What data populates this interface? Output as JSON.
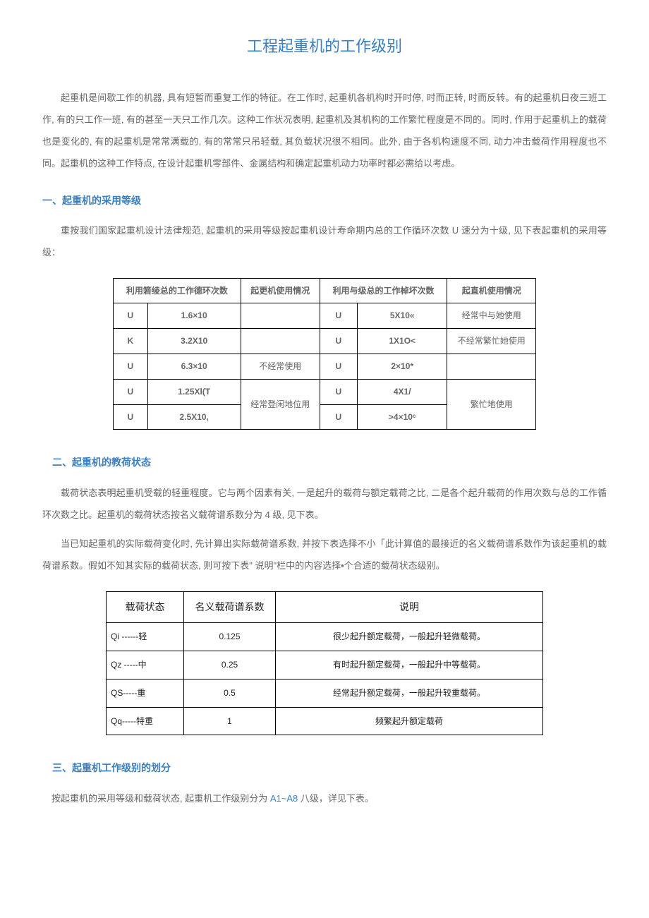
{
  "title": "工程起重机的工作级别",
  "intro": "起重机是间歇工作的机器, 具有短暂而重复工作的特征。在工作时, 起重机各机构时开时停, 时而正转, 时而反转。有的起重机日夜三班工作, 有的只工作一班, 有的甚至一天只工作几次。这种工作状况表明, 起重机及其机构的工作繁忙程度是不同的。同时, 作用于起重机上的载荷也是变化的, 有的起重机是常常满载的, 有的常常只吊轻载, 其负载状况很不相同。此外, 由于各机构速度不同, 动力冲击载荷作用程度也不同。起重机的这种工作特点, 在设计起重机零部件、金属结构和确定起重机动力功率时都必需给以考虑。",
  "sec1": {
    "heading": "一、起重机的采用等级",
    "p1": "重按我们国家起重机设计法律规范, 起重机的采用等级按起重机设计寿命期内总的工作循环次数 U 速分为十级, 见下表起重机的采用等级："
  },
  "table1": {
    "h1": "利用箬绫总的工作德环次数",
    "h2": "起更机使用情况",
    "h3": "利用与级总的工作棹坏次数",
    "h4": "起直机使用情况",
    "rows": [
      {
        "a": "U",
        "b": "1.6×10",
        "c": "",
        "d": "U",
        "e": "5X10«",
        "f": "经常中与她使用"
      },
      {
        "a": "K",
        "b": "3.2X10",
        "c": "",
        "d": "U",
        "e": "1X1O<",
        "f": "不经常繁忙她使用"
      },
      {
        "a": "U",
        "b": "6.3×10",
        "c": "不经常使用",
        "d": "U",
        "e": "2×10*",
        "f": ""
      },
      {
        "a": "U",
        "b": "1.25Xl(T",
        "c": "经常登闲地位用",
        "d": "U",
        "e": "4X1/",
        "f": "繁忙地使用",
        "rs": 2
      },
      {
        "a": "U",
        "b": "2.5X10,",
        "d": "U",
        "e": ">4×10ᶜ"
      }
    ]
  },
  "sec2": {
    "heading": "二、起重机的教荷状态",
    "p1": "载荷状态表明起重机受载的轻重程度。它与两个因素有关, 一是起升的载荷与额定载荷之比, 二是各个起升载荷的作用次数与总的工作循环次数之比。起重机的载荷状态按名义载荷谱系数分为 4 级, 见下表。",
    "p2": "当已知起重机的实际载荷变化时, 先计算出实际载荷谱系数, 并按下表选择不小「此计算值的最接近的名义载荷谱系数作为该起重机的载荷谱系数。假如不知其实际的载荷状态, 则可按下表\" 说明\"栏中的内容选择•个合适的载荷状态级别。"
  },
  "table2": {
    "h1": "载荷状态",
    "h2": "名义载荷谱系数",
    "h3": "说明",
    "rows": [
      {
        "a": "Qi ------轻",
        "b": "0.125",
        "c": "很少起升额定载荷，一般起升轻微载荷。"
      },
      {
        "a": "Qz -----中",
        "b": "0.25",
        "c": "有时起升额定载荷，一般起升中等载荷。"
      },
      {
        "a": "QS-----重",
        "b": "0.5",
        "c": "经常起升额定载荷，一般起升较重载荷。"
      },
      {
        "a": "Qq-----特重",
        "b": "1",
        "c": "频繁起升额定载荷"
      }
    ]
  },
  "sec3": {
    "heading": "三、起重机工作级别的划分",
    "p1_pre": "按起重机的采用等级和载荷状态, 起重机工作级别分为 ",
    "p1_hl": "A1~A8",
    "p1_post": " 八级，详见下表。"
  }
}
